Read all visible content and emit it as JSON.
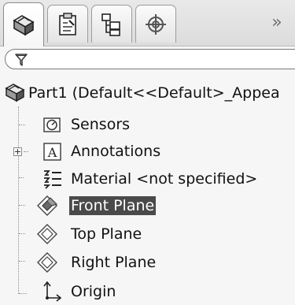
{
  "tabs": [
    {
      "name": "FeatureManager",
      "icon": "feature-tree-icon",
      "active": true
    },
    {
      "name": "PropertyManager",
      "icon": "property-manager-icon",
      "active": false
    },
    {
      "name": "ConfigurationManager",
      "icon": "configuration-manager-icon",
      "active": false
    },
    {
      "name": "DimXpertManager",
      "icon": "dimxpert-manager-icon",
      "active": false
    }
  ],
  "overflow_label": "»",
  "filter": {
    "icon": "filter-icon",
    "value": ""
  },
  "tree": {
    "root": {
      "label": "Part1  (Default<<Default>_Appea",
      "icon": "part-icon"
    },
    "items": [
      {
        "label": "Sensors",
        "icon": "sensors-icon"
      },
      {
        "label": "Annotations",
        "icon": "annotations-icon",
        "expandable": true
      },
      {
        "label": "Material <not specified>",
        "icon": "material-icon"
      },
      {
        "label": "Front Plane",
        "icon": "plane-icon",
        "selected": true
      },
      {
        "label": "Top Plane",
        "icon": "plane-icon"
      },
      {
        "label": "Right Plane",
        "icon": "plane-icon"
      },
      {
        "label": "Origin",
        "icon": "origin-icon"
      }
    ]
  },
  "colors": {
    "selection_bg": "#4a4a4a",
    "selection_text": "#ffffff",
    "panel_bg": "#f6f6f6"
  }
}
